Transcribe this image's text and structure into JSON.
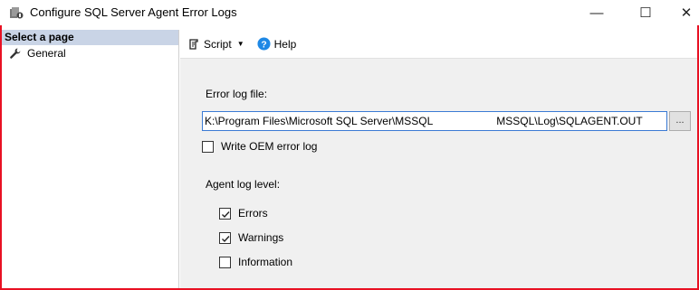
{
  "window": {
    "title": "Configure SQL Server Agent Error Logs",
    "minimize_glyph": "—",
    "maximize_glyph": "☐",
    "close_glyph": "✕"
  },
  "sidebar": {
    "header": "Select a page",
    "items": [
      {
        "label": "General",
        "icon": "wrench-icon"
      }
    ]
  },
  "toolbar": {
    "script_label": "Script",
    "help_label": "Help"
  },
  "form": {
    "error_log_file_label": "Error log file:",
    "error_log_file_value_prefix": "K:\\Program Files\\Microsoft SQL Server\\MSSQL",
    "error_log_file_value_suffix": "MSSQL\\Log\\SQLAGENT.OUT",
    "browse_label": "...",
    "write_oem_label": "Write OEM error log",
    "write_oem_checked": false,
    "agent_log_level_label": "Agent log level:",
    "levels": [
      {
        "label": "Errors",
        "checked": true
      },
      {
        "label": "Warnings",
        "checked": true
      },
      {
        "label": "Information",
        "checked": false
      }
    ]
  },
  "colors": {
    "accent_border": "#e81123",
    "sidebar_header_bg": "#c9d4e6",
    "input_focus_border": "#3b7bd4",
    "help_icon": "#1e88e5"
  }
}
